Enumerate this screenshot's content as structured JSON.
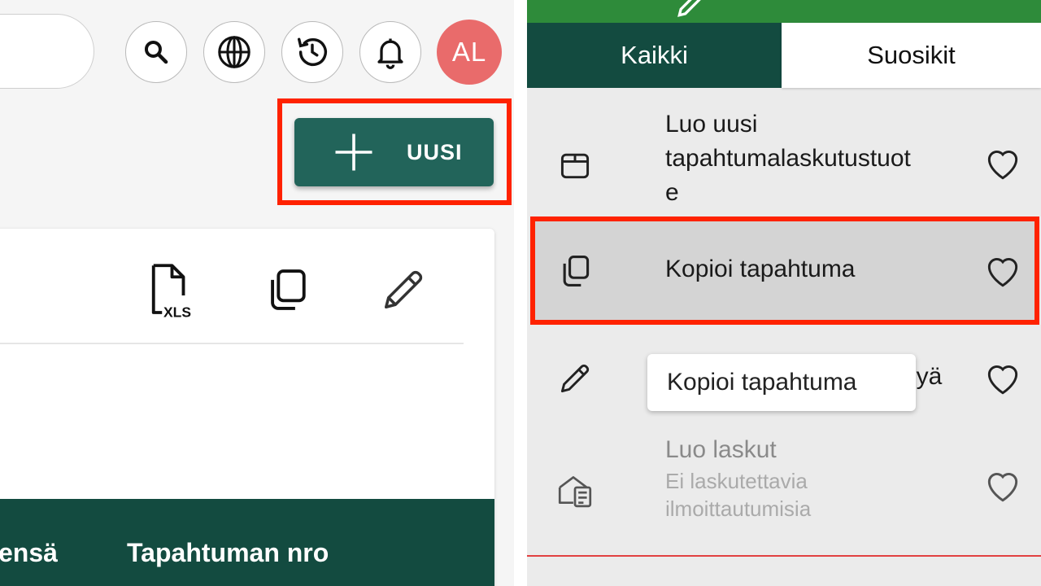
{
  "header": {
    "search_icon": "search-icon",
    "language_icon": "globe-icon",
    "history_icon": "history-icon",
    "notifications_icon": "bell-icon",
    "avatar_initials": "AL",
    "avatar_color": "#e96b6b"
  },
  "toolbar": {
    "new_button_label": "UUSI",
    "accent": "#22645a",
    "highlight_color": "#ff2200"
  },
  "card": {
    "export_icon": "xls-file-icon",
    "export_icon_text": "XLS",
    "copy_icon": "copy-icon",
    "edit_icon": "pencil-icon"
  },
  "table": {
    "columns": [
      "ensä",
      "Tapahtuman nro"
    ]
  },
  "panel": {
    "tabs": [
      {
        "label": "Kaikki",
        "active": true
      },
      {
        "label": "Suosikit",
        "active": false
      }
    ],
    "items": [
      {
        "icon": "box-icon",
        "label_lines": [
          "Luo uusi",
          "tapahtumalaskutustuot",
          "e"
        ],
        "favorite_icon": "heart-icon"
      },
      {
        "icon": "copy-icon",
        "label": "Kopioi tapahtuma",
        "favorite_icon": "heart-icon",
        "selected": true
      },
      {
        "icon": "pencil-icon",
        "label_suffix": "lyä",
        "favorite_icon": "heart-icon"
      },
      {
        "icon": "invoice-icon",
        "label": "Luo laskut",
        "sub_lines": [
          "Ei laskutettavia",
          "ilmoittautumisia"
        ],
        "favorite_icon": "heart-icon",
        "disabled": true
      }
    ],
    "tooltip": "Kopioi tapahtuma"
  }
}
